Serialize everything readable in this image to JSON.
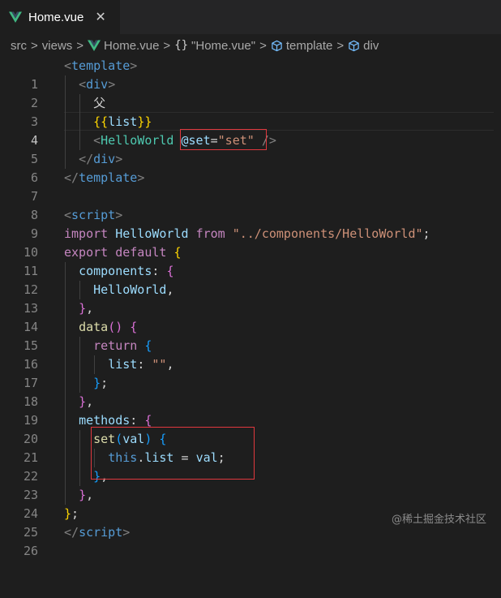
{
  "tab": {
    "filename": "Home.vue",
    "close_glyph": "✕",
    "icon": "vue-icon"
  },
  "breadcrumb": {
    "parts": [
      "src",
      "views",
      "Home.vue",
      "{}",
      "\"Home.vue\"",
      "template",
      "div"
    ],
    "separator": ">"
  },
  "editor": {
    "line_numbers": [
      "1",
      "2",
      "3",
      "4",
      "5",
      "6",
      "7",
      "8",
      "9",
      "10",
      "11",
      "12",
      "13",
      "14",
      "15",
      "16",
      "17",
      "18",
      "19",
      "20",
      "21",
      "22",
      "23",
      "24",
      "25",
      "26"
    ],
    "active_line": "4",
    "lines": {
      "l1": {
        "a": "<",
        "b": "template",
        "c": ">"
      },
      "l2": {
        "a": "<",
        "b": "div",
        "c": ">"
      },
      "l3": {
        "a": "父"
      },
      "l4": {
        "a": "{{",
        "b": "list",
        "c": "}}"
      },
      "l5": {
        "a": "<",
        "b": "HelloWorld",
        "c": "@set",
        "d": "=",
        "e": "\"set\"",
        "f": " />"
      },
      "l6": {
        "a": "</",
        "b": "div",
        "c": ">"
      },
      "l7": {
        "a": "</",
        "b": "template",
        "c": ">"
      },
      "l9": {
        "a": "<",
        "b": "script",
        "c": ">"
      },
      "l10": {
        "a": "import",
        "b": "HelloWorld",
        "c": "from",
        "d": "\"../components/HelloWorld\"",
        "e": ";"
      },
      "l11": {
        "a": "export",
        "b": "default",
        "c": "{"
      },
      "l12": {
        "a": "components",
        "b": ":",
        "c": "{"
      },
      "l13": {
        "a": "HelloWorld",
        "b": ","
      },
      "l14": {
        "a": "}",
        "b": ","
      },
      "l15": {
        "a": "data",
        "b": "()",
        "c": "{"
      },
      "l16": {
        "a": "return",
        "b": "{"
      },
      "l17": {
        "a": "list",
        "b": ":",
        "c": "\"\"",
        "d": ","
      },
      "l18": {
        "a": "}",
        "b": ";"
      },
      "l19": {
        "a": "}",
        "b": ","
      },
      "l20": {
        "a": "methods",
        "b": ":",
        "c": "{"
      },
      "l21": {
        "a": "set",
        "b": "(",
        "c": "val",
        "d": ")",
        "e": "{"
      },
      "l22": {
        "a": "this",
        "b": ".",
        "c": "list",
        "d": " = ",
        "e": "val",
        "f": ";"
      },
      "l23": {
        "a": "}",
        "b": ","
      },
      "l24": {
        "a": "}",
        "b": ","
      },
      "l25": {
        "a": "}",
        "b": ";"
      },
      "l26": {
        "a": "</",
        "b": "script",
        "c": ">"
      }
    }
  },
  "watermark": "@稀土掘金技术社区",
  "colors": {
    "background": "#1e1e1e",
    "tag": "#569cd6",
    "component": "#4ec9b0",
    "attribute": "#9cdcfe",
    "string": "#ce9178",
    "keyword": "#c586c0",
    "function": "#dcdcaa",
    "highlight_box": "#e0383e"
  }
}
